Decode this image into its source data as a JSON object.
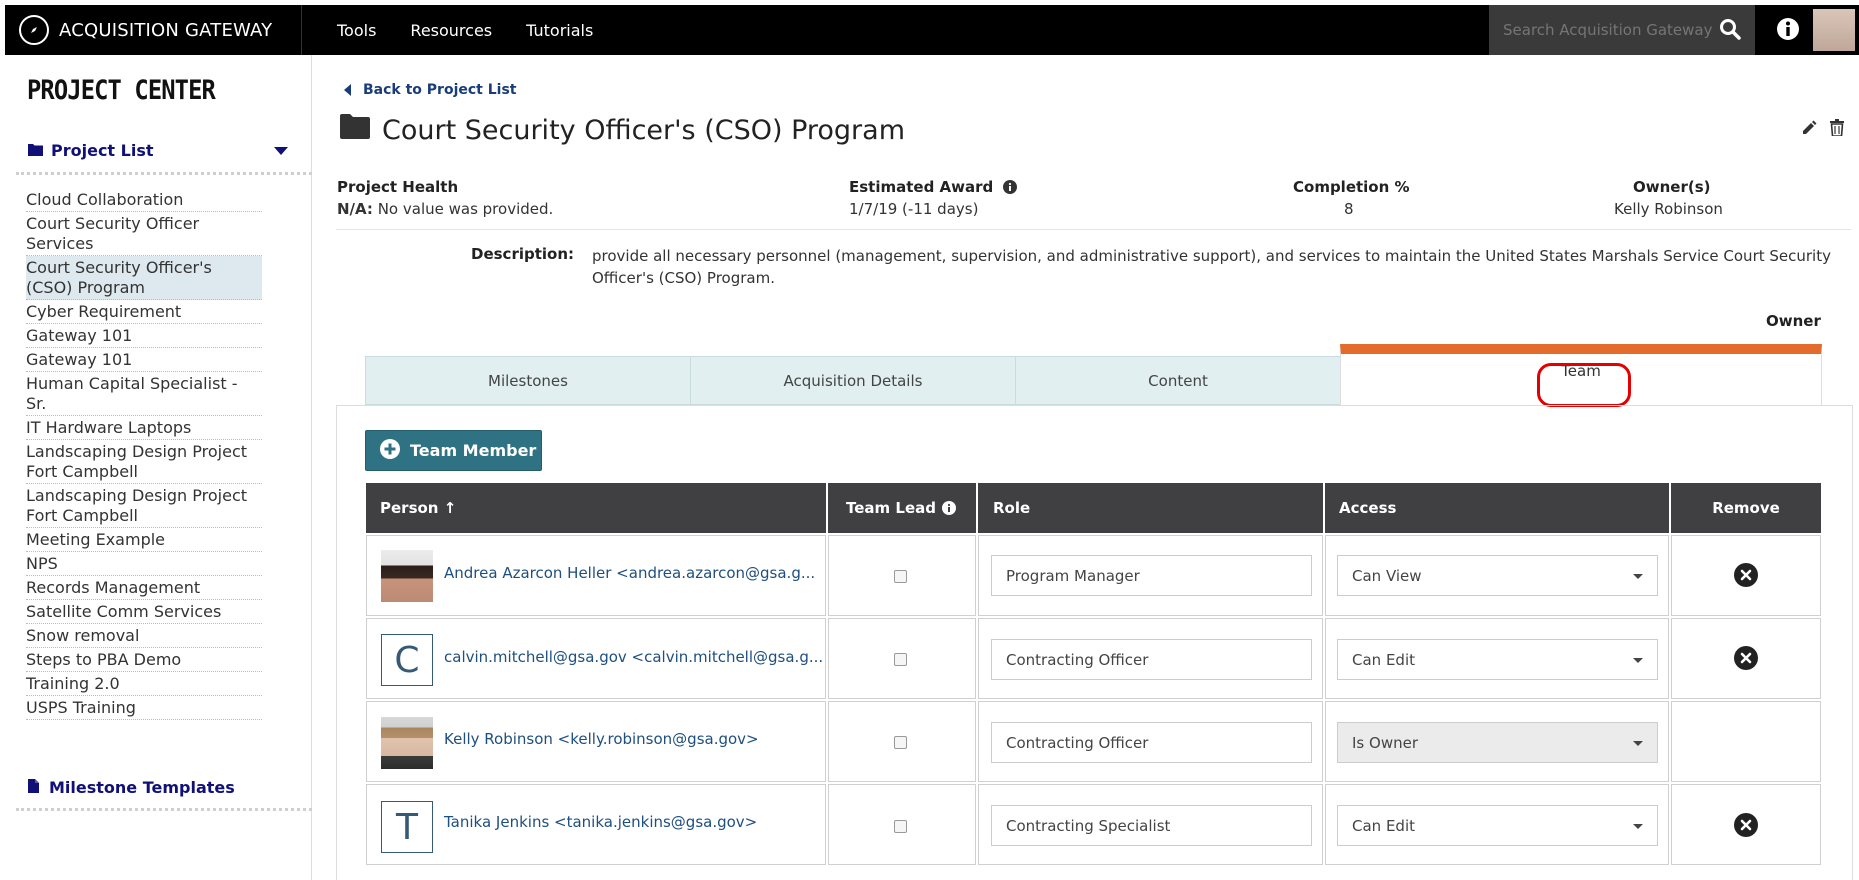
{
  "app": {
    "brand": "ACQUISITION GATEWAY",
    "nav": [
      "Tools",
      "Resources",
      "Tutorials"
    ],
    "search_placeholder": "Search Acquisition Gateway"
  },
  "sidebar": {
    "title": "PROJECT CENTER",
    "project_list_label": "Project List",
    "projects": [
      "Cloud Collaboration",
      "Court Security Officer Services",
      "Court Security Officer's (CSO) Program",
      "Cyber Requirement",
      "Gateway 101",
      "Gateway 101",
      "Human Capital Specialist - Sr.",
      "IT Hardware Laptops",
      "Landscaping Design Project Fort Campbell",
      "Landscaping Design Project Fort Campbell",
      "Meeting Example",
      "NPS",
      "Records Management",
      "Satellite Comm Services",
      "Snow removal",
      "Steps to PBA Demo",
      "Training 2.0",
      "USPS Training"
    ],
    "milestone_templates_label": "Milestone Templates"
  },
  "main": {
    "back_link": "Back to Project List",
    "title": "Court Security Officer's (CSO) Program",
    "meta": {
      "health_label": "Project Health",
      "health_value_bold": "N/A:",
      "health_value": "No value was provided.",
      "award_label": "Estimated Award",
      "award_value": "1/7/19 (-11 days)",
      "completion_label": "Completion %",
      "completion_value": "8",
      "owners_label": "Owner(s)",
      "owners_value": "Kelly Robinson"
    },
    "description_label": "Description:",
    "description": "provide all necessary personnel (management, supervision, and administrative support), and services to maintain the United States Marshals Service Court Security Officer's (CSO) Program.",
    "owner_badge": "Owner",
    "tabs": [
      "Milestones",
      "Acquisition Details",
      "Content",
      "Team"
    ],
    "active_tab": "Team",
    "add_button": "Team Member",
    "table": {
      "headers": {
        "person": "Person ↑",
        "team_lead": "Team Lead",
        "role": "Role",
        "access": "Access",
        "remove": "Remove"
      },
      "rows": [
        {
          "avatar": "photo",
          "name": "Andrea Azarcon Heller <andrea.azarcon@gsa.g...",
          "role": "Program Manager",
          "access": "Can View",
          "removable": true
        },
        {
          "avatar": "C",
          "name": "calvin.mitchell@gsa.gov <calvin.mitchell@gsa.g...",
          "role": "Contracting Officer",
          "access": "Can Edit",
          "removable": true
        },
        {
          "avatar": "photo",
          "name": "Kelly Robinson <kelly.robinson@gsa.gov>",
          "role": "Contracting Officer",
          "access": "Is Owner",
          "removable": false
        },
        {
          "avatar": "T",
          "name": "Tanika Jenkins <tanika.jenkins@gsa.gov>",
          "role": "Contracting Specialist",
          "access": "Can Edit",
          "removable": true
        }
      ]
    }
  },
  "colors": {
    "accent_orange": "#e36b2c",
    "button_teal": "#2f7283",
    "nav_blue": "#101077",
    "highlight_red": "#e40000"
  }
}
